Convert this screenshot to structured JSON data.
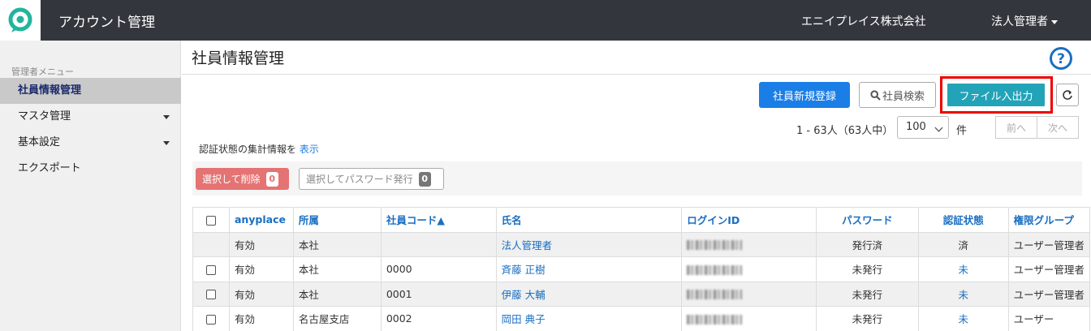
{
  "header": {
    "app_title": "アカウント管理",
    "company": "エニイプレイス株式会社",
    "user": "法人管理者"
  },
  "sidebar": {
    "section_label": "管理者メニュー",
    "items": [
      {
        "label": "社員情報管理",
        "active": true
      },
      {
        "label": "マスタ管理",
        "has_submenu": true
      },
      {
        "label": "基本設定",
        "has_submenu": true
      },
      {
        "label": "エクスポート"
      }
    ]
  },
  "page": {
    "title": "社員情報管理",
    "buttons": {
      "new": "社員新規登録",
      "search": "社員検索",
      "file": "ファイル入出力"
    },
    "count_text": "1 - 63人（63人中）",
    "per_page": "100",
    "per_unit": "件",
    "prev": "前へ",
    "next": "次へ",
    "auth_summary_text": "認証状態の集計情報を",
    "auth_summary_link": "表示",
    "bulk_delete": "選択して削除",
    "bulk_delete_count": "0",
    "bulk_password": "選択してパスワード発行",
    "bulk_password_count": "0"
  },
  "table": {
    "headers": [
      "anyplace",
      "所属",
      "社員コード▲",
      "氏名",
      "ログインID",
      "パスワード",
      "認証状態",
      "権限グループ"
    ],
    "rows": [
      {
        "anyplace": "有効",
        "dept": "本社",
        "code": "",
        "name": "法人管理者",
        "password": "発行済",
        "auth": "済",
        "group": "ユーザー管理者"
      },
      {
        "anyplace": "有効",
        "dept": "本社",
        "code": "0000",
        "name": "斉藤 正樹",
        "password": "未発行",
        "auth": "未",
        "group": "ユーザー管理者"
      },
      {
        "anyplace": "有効",
        "dept": "本社",
        "code": "0001",
        "name": "伊藤 大輔",
        "password": "未発行",
        "auth": "未",
        "group": "ユーザー管理者"
      },
      {
        "anyplace": "有効",
        "dept": "名古屋支店",
        "code": "0002",
        "name": "岡田 典子",
        "password": "未発行",
        "auth": "未",
        "group": "ユーザー"
      }
    ]
  }
}
